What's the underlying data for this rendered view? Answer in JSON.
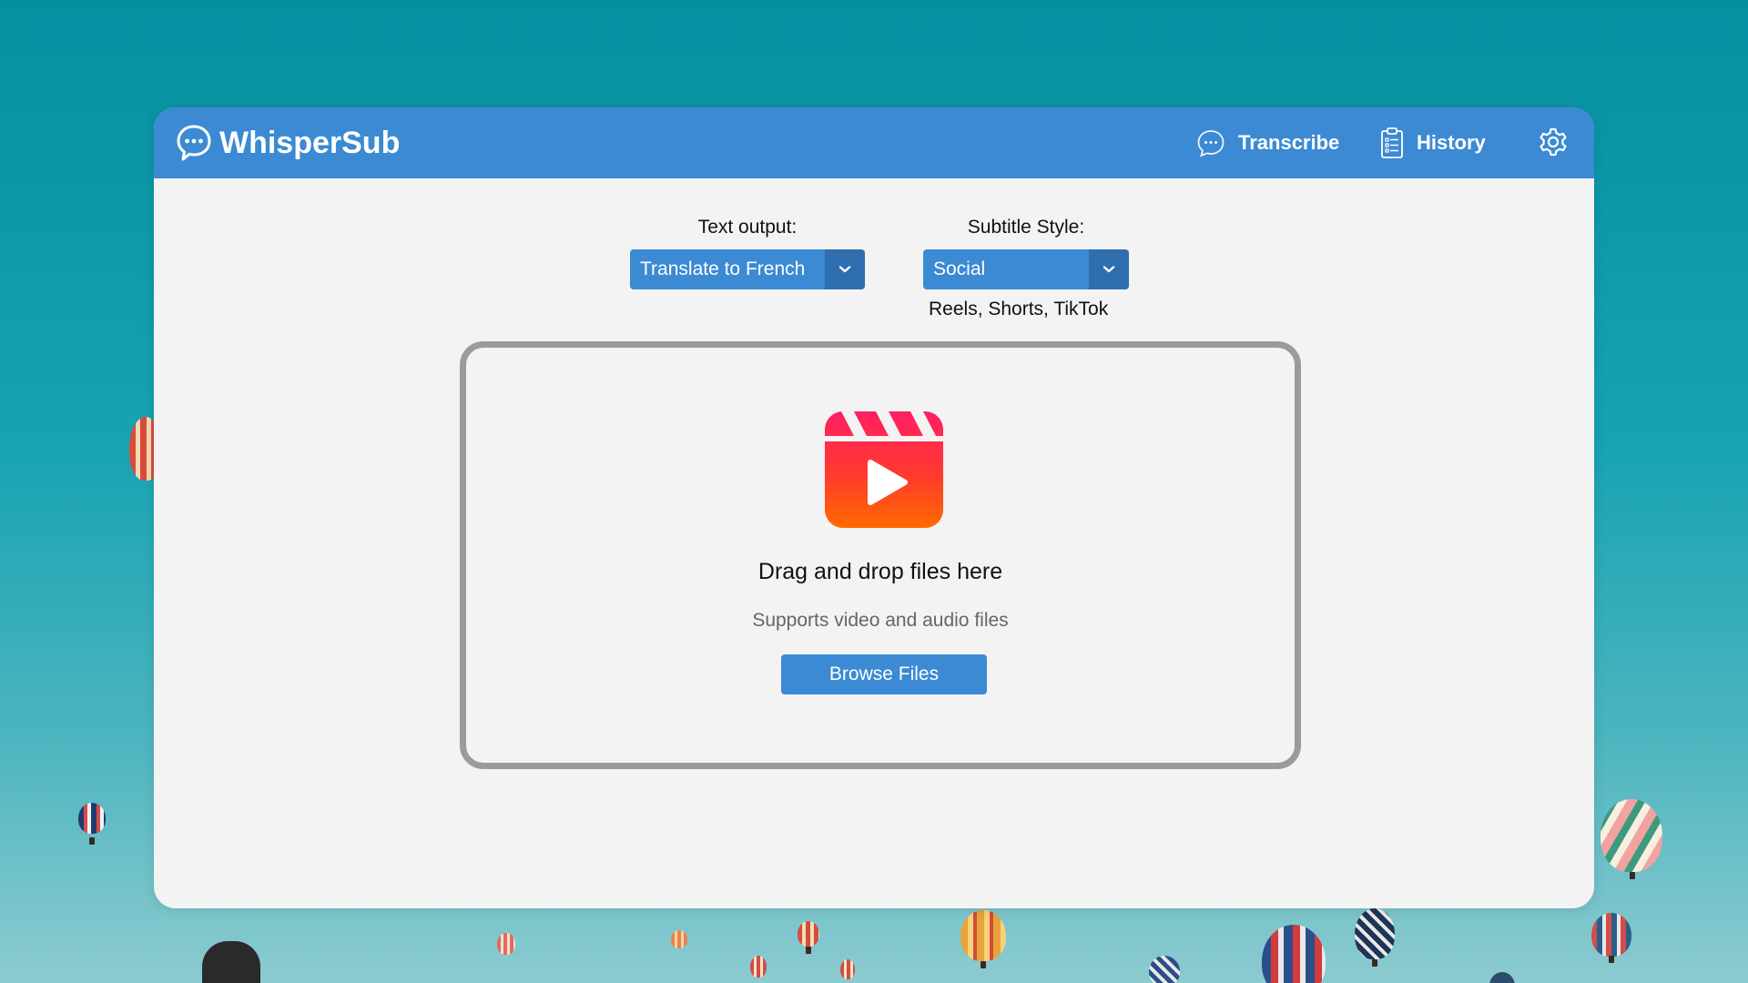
{
  "app": {
    "title": "WhisperSub"
  },
  "nav": {
    "transcribe_label": "Transcribe",
    "history_label": "History"
  },
  "text_output": {
    "label": "Text output:",
    "selected": "Translate to French"
  },
  "subtitle_style": {
    "label": "Subtitle Style:",
    "selected": "Social",
    "hint": "Reels, Shorts, TikTok"
  },
  "dropzone": {
    "title": "Drag and drop files here",
    "subtitle": "Supports video and audio files",
    "browse_label": "Browse Files"
  },
  "colors": {
    "accent": "#3b8ad3",
    "accent_dark": "#2f6fb0",
    "panel_bg": "#f3f3f3",
    "dropzone_border": "#9b9b9b",
    "reel_icon_top": "#ff2a5a",
    "reel_icon_bottom": "#ff6a00"
  },
  "icons": {
    "logo": "chat-bubble-icon",
    "transcribe": "chat-bubble-icon",
    "history": "clipboard-icon",
    "settings": "gear-icon",
    "dropzone": "reels-play-icon",
    "dropdown": "chevron-down-icon"
  }
}
